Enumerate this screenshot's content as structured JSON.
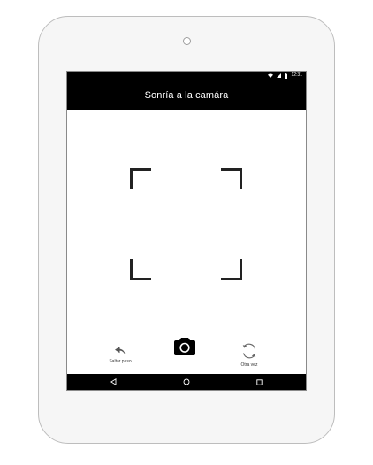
{
  "status_bar": {
    "time": "12:31",
    "icons": [
      "wifi-icon",
      "signal-icon",
      "battery-icon"
    ]
  },
  "app_bar": {
    "title": "Sonría a la camára"
  },
  "viewfinder": {
    "icon": "face-frame"
  },
  "actions": {
    "skip": {
      "label": "Saltar paso",
      "icon": "back-arrow-icon"
    },
    "capture": {
      "icon": "camera-icon"
    },
    "retry": {
      "label": "Otra vez",
      "icon": "refresh-icon"
    }
  },
  "nav_bar": {
    "icons": [
      "back-triangle-icon",
      "home-circle-icon",
      "recent-square-icon"
    ]
  },
  "colors": {
    "bar_background": "#000000",
    "screen_background": "#ffffff",
    "device_body": "#f6f6f6",
    "frame_stroke": "#222222"
  }
}
